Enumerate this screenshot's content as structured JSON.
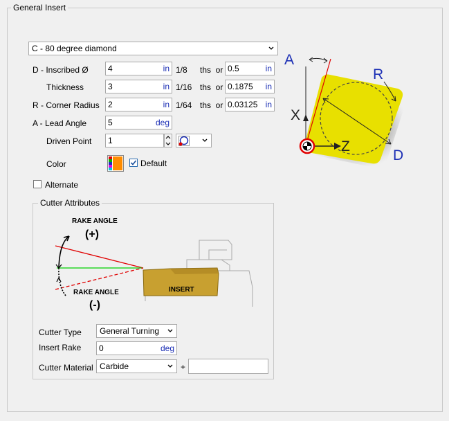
{
  "group": {
    "title": "General Insert"
  },
  "shape_select": {
    "value": "C - 80 degree diamond"
  },
  "fields": {
    "inscribed": {
      "label": "D - Inscribed Ø",
      "value": "4",
      "unit": "in",
      "fraction": "1/8",
      "ths_or": "ths  or",
      "decimal": "0.5",
      "decimal_unit": "in"
    },
    "thickness": {
      "label": "Thickness",
      "value": "3",
      "unit": "in",
      "fraction": "1/16",
      "ths_or": "ths  or",
      "decimal": "0.1875",
      "decimal_unit": "in"
    },
    "corner_radius": {
      "label": "R - Corner Radius",
      "value": "2",
      "unit": "in",
      "fraction": "1/64",
      "ths_or": "ths  or",
      "decimal": "0.03125",
      "decimal_unit": "in"
    },
    "lead_angle": {
      "label": "A - Lead Angle",
      "value": "5",
      "unit": "deg"
    },
    "driven_point": {
      "label": "Driven Point",
      "value": "1"
    },
    "color": {
      "label": "Color",
      "default_label": "Default",
      "default_checked": true
    }
  },
  "alternate": {
    "label": "Alternate",
    "checked": false
  },
  "diagram": {
    "a": "A",
    "r": "R",
    "x": "X",
    "z": "Z",
    "d": "D"
  },
  "cutter": {
    "title": "Cutter Attributes",
    "rake_pos_title": "RAKE ANGLE",
    "rake_pos_sign": "(+)",
    "rake_neg_title": "RAKE ANGLE",
    "rake_neg_sign": "(-)",
    "insert_text": "INSERT",
    "cutter_type_label": "Cutter Type",
    "cutter_type_value": "General Turning",
    "insert_rake_label": "Insert Rake",
    "insert_rake_value": "0",
    "insert_rake_unit": "deg",
    "material_label": "Cutter Material",
    "material_value": "Carbide",
    "material_plus": "+",
    "material_extra": ""
  },
  "colors": {
    "accent_blue": "#1c2fb5",
    "insert_yellow": "#e8e000",
    "insert_gold": "#c8a030",
    "red_line": "#e00000",
    "green_line": "#00d000"
  }
}
